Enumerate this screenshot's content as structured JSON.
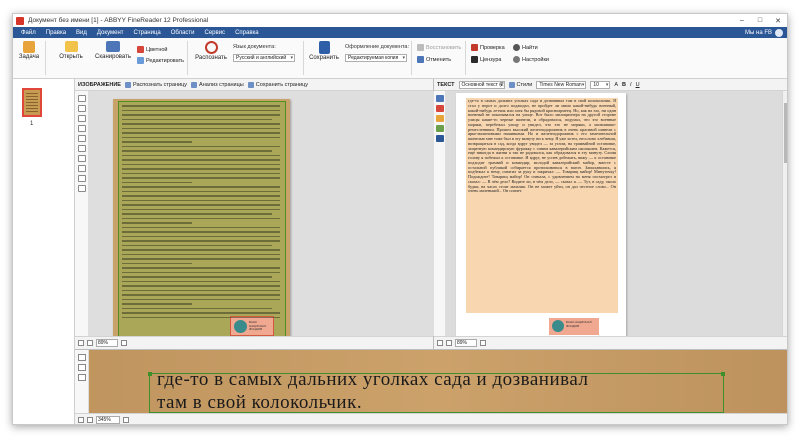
{
  "window": {
    "title": "Документ без имени [1] - ABBYY FineReader 12 Professional",
    "controls": [
      "–",
      "□",
      "✕"
    ]
  },
  "menu": {
    "items": [
      "Файл",
      "Правка",
      "Вид",
      "Документ",
      "Страница",
      "Области",
      "Сервис",
      "Справка"
    ],
    "account": "Мы на FB"
  },
  "ribbon": {
    "task": "Задача",
    "open": "Открыть",
    "scan": "Сканировать",
    "color": "Цветной",
    "edit": "Редактировать",
    "recognize": "Распознать",
    "language_label": "Язык документа:",
    "language_value": "Русский и английский",
    "save": "Сохранить",
    "format_label": "Оформление документа:",
    "format_value": "Редактируемая копия",
    "restore": "Восстановить",
    "cancel": "Отменить",
    "check": "Проверка",
    "find": "Найти",
    "censor": "Цензура",
    "settings": "Настройки"
  },
  "thumbnails": {
    "page_number": "1"
  },
  "image_pane": {
    "title": "ИЗОБРАЖЕНИЕ",
    "recognize_page": "Распознать страницу",
    "analyze_page": "Анализ страницы",
    "save_page": "Сохранить страницу",
    "zoom": "89%",
    "image_caption_line1": "БАНК НАЦИОНАЛ.",
    "image_caption_line2": "ФОНДОВ"
  },
  "text_pane": {
    "title": "ТЕКСТ",
    "style": "Основной текст (2)",
    "styles_label": "Стили",
    "font": "Times New Roman",
    "size": "10",
    "zoom": "89%",
    "body": "где-то в самых дальних уголках сада и дозванивал там в свой колокольчик. Я стал у ворот и долго поджидал, не пройдет ли мимо какой-нибудь военный, какой-нибудь летчик или хотя бы рядовой красноармеец. Но, как на зло, ни один военный не показывался на улице. Вот было милиционера на другой стороне улицы какие-то черные шинели, и обрадовался, подумал, что это военные моряки, перебежал улицу и увидел, что это не моряки, а мальчишки-ремесленники. Прошел высокий железнодорожник в очень красивой шинели с ярко-малиновыми нашивками. Но и железнодорожник с его замечательной шинелью мне тоже был в эту минуту ни к чему. Я уже хотел, несолоно хлебавши, возвращаться в сад, когда вдруг увидел — за углом, на трамвайной остановке, защитную командирскую фуражку с синим кавалерийским околышем. Кажется, ещё никогда в жизни я так не радовался, как обрадовался в эту минуту. Сломя голову я побежал к остановке. И вдруг, не успев добежать, вижу — к остановке подходит трамвай и командир, молодой кавалерийский майор, вместе с остальной публикой собирается протискиваться в вагон. Запыхавшись, я подбежал к нему, схватил за руку и закричал: — Товарищ майор! Минуточку! Подождите! Товарищ майор! Он сначала, с удивлением на меня посмотрел и сказал: — В чём дело? Видите ли, в чём дело, — сказал я. — Тут, в саду, около будки, на часах стоит мальчик. Он не может уйти, он дал честное слово... Он очень маленький... Он плачет.",
    "image_caption_line1": "БАНК НАЦИОНАЛ.",
    "image_caption_line2": "ФОНДОВ"
  },
  "zoom_pane": {
    "line1": "где-то в самых дальних уголках сада и дозванивал",
    "line2": "там в свой колокольчик.",
    "zoom": "345%"
  }
}
